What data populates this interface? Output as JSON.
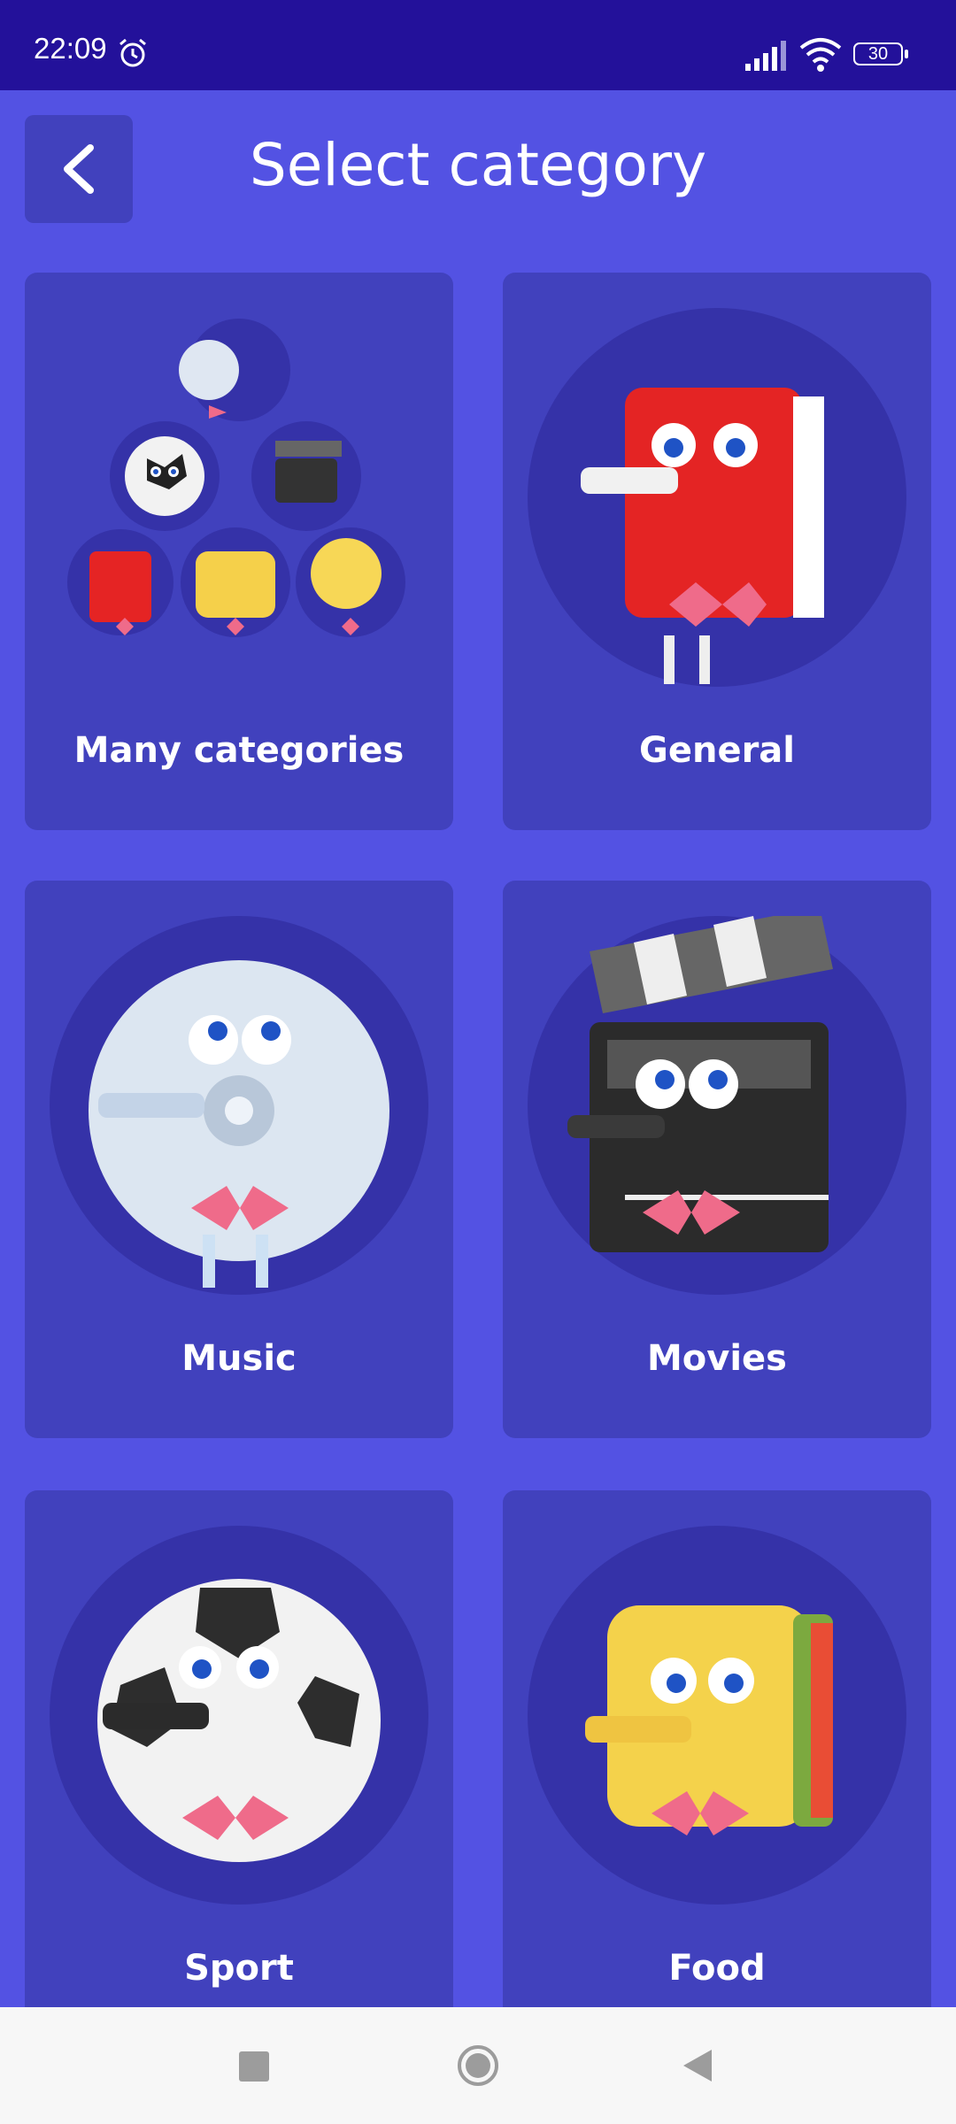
{
  "status_bar": {
    "time": "22:09",
    "battery_level": "30",
    "icons": [
      "alarm-icon",
      "signal-icon",
      "wifi-icon",
      "battery-icon"
    ]
  },
  "header": {
    "title": "Select category",
    "back_icon": "chevron-left-icon"
  },
  "categories": [
    {
      "label": "Many categories",
      "illustration": "group-of-mascots"
    },
    {
      "label": "General",
      "illustration": "book-mascot"
    },
    {
      "label": "Music",
      "illustration": "cd-mascot"
    },
    {
      "label": "Movies",
      "illustration": "clapperboard-mascot"
    },
    {
      "label": "Sport",
      "illustration": "soccer-ball-mascot"
    },
    {
      "label": "Food",
      "illustration": "sandwich-mascot"
    }
  ],
  "colors": {
    "background": "#5352e3",
    "status_bar": "#23119a",
    "card": "#4141bd",
    "circle": "#3532a8",
    "text": "#ffffff"
  },
  "nav_bar": {
    "icons": [
      "recent-apps-icon",
      "home-icon",
      "back-icon"
    ]
  }
}
